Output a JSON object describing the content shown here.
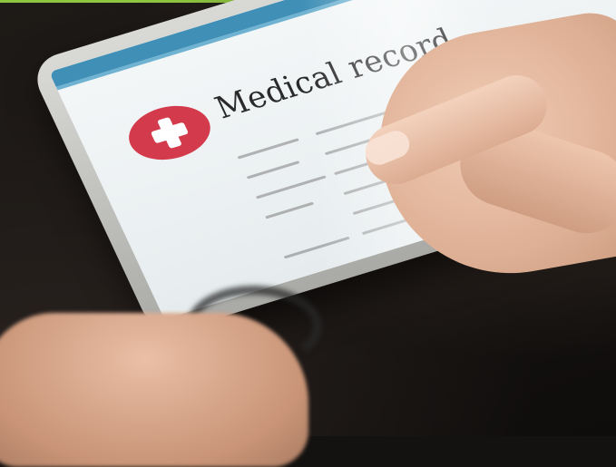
{
  "screen": {
    "title": "Medical record"
  },
  "colors": {
    "accent_bar": "#8fc63f",
    "screen_header": "#3f8fb7",
    "logo_red": "#d33a4c"
  },
  "icons": {
    "logo": "medical-cross-icon"
  }
}
